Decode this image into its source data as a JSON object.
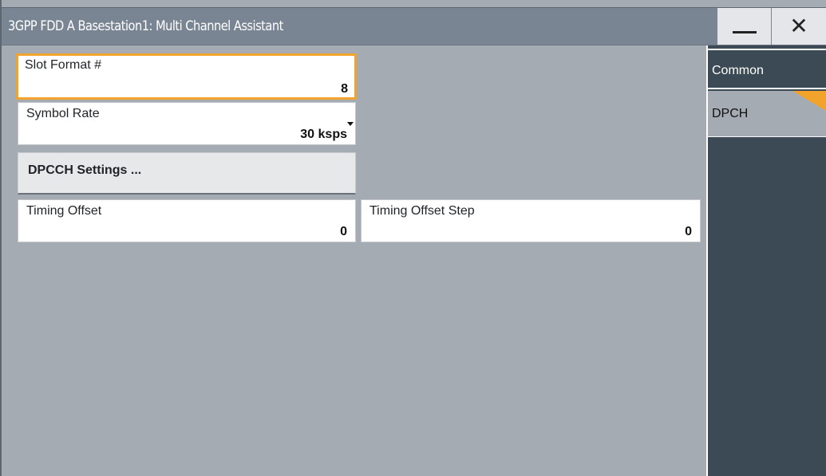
{
  "window": {
    "title": "3GPP FDD A Basestation1: Multi Channel Assistant",
    "minimize_icon": "minimize-icon",
    "close_icon": "close-icon",
    "close_glyph": "✕"
  },
  "fields": {
    "slot_format": {
      "label": "Slot Format #",
      "value": "8"
    },
    "symbol_rate": {
      "label": "Symbol Rate",
      "value": "30 ksps"
    },
    "timing_offset": {
      "label": "Timing Offset",
      "value": "0"
    },
    "timing_offset_step": {
      "label": "Timing Offset Step",
      "value": "0"
    }
  },
  "buttons": {
    "dpcch_settings": "DPCCH Settings ..."
  },
  "tabs": [
    {
      "label": "Common",
      "selected": false
    },
    {
      "label": "DPCH",
      "selected": true
    }
  ],
  "colors": {
    "focus_accent": "#f1a32c",
    "titlebar": "#7a8594",
    "content_bg": "#a4abb2",
    "sidebar_bg": "#3b4a54"
  }
}
